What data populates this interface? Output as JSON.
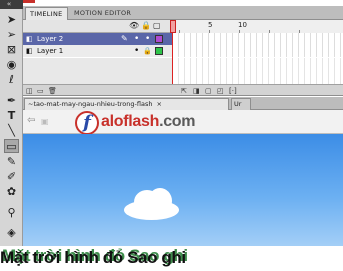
{
  "panel": {
    "tab_timeline": "TIMELINE",
    "tab_motion": "MOTION EDITOR"
  },
  "toolbar": {
    "grip": "«",
    "tools": [
      "selection-tool",
      "subselection-tool",
      "free-transform-tool",
      "3d-rotation-tool",
      "lasso-tool",
      "pen-tool",
      "text-tool",
      "line-tool",
      "rectangle-tool",
      "pencil-tool",
      "brush-tool",
      "deco-tool",
      "bone-tool",
      "paint-bucket-tool"
    ]
  },
  "timeline": {
    "ruler": [
      "5",
      "10"
    ],
    "layers": [
      {
        "name": "Layer 2",
        "selected": true
      },
      {
        "name": "Layer 1",
        "selected": false
      }
    ]
  },
  "document": {
    "tab_title": "~tao-mat-may-ngau-nhieu-trong-flash",
    "tab_close": "×",
    "tab2": "Ur"
  },
  "brand": {
    "name": "aloflash",
    "suffix": ".com",
    "logo_letter": "f",
    "color": "#c8312b"
  },
  "caption": {
    "text": "Mặt trời hình đỏ Sao ghi"
  },
  "colors": {
    "sky_top": "#3c8de6",
    "sky_bottom": "#a8d1f7",
    "layer_selected": "#5a66a8"
  }
}
